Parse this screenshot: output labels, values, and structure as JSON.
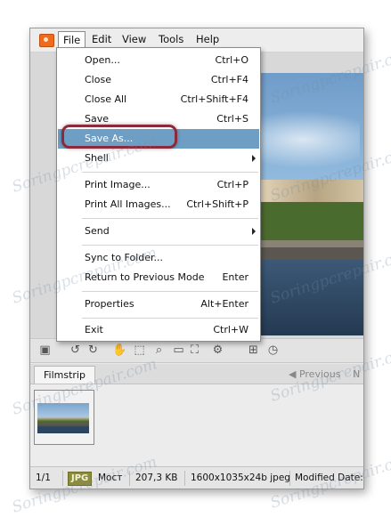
{
  "menubar": {
    "items": [
      {
        "label": "File",
        "open": true
      },
      {
        "label": "Edit"
      },
      {
        "label": "View"
      },
      {
        "label": "Tools"
      },
      {
        "label": "Help"
      }
    ]
  },
  "file_menu": {
    "items": [
      {
        "label": "Open...",
        "shortcut": "Ctrl+O"
      },
      {
        "label": "Close",
        "shortcut": "Ctrl+F4"
      },
      {
        "label": "Close All",
        "shortcut": "Ctrl+Shift+F4"
      },
      {
        "label": "Save",
        "shortcut": "Ctrl+S"
      },
      {
        "label": "Save As...",
        "shortcut": "",
        "highlighted": true
      },
      {
        "label": "Shell",
        "shortcut": "",
        "submenu": true
      },
      {
        "label": "Print Image...",
        "shortcut": "Ctrl+P"
      },
      {
        "label": "Print All Images...",
        "shortcut": "Ctrl+Shift+P"
      },
      {
        "label": "Send",
        "shortcut": "",
        "submenu": true
      },
      {
        "label": "Sync to Folder...",
        "shortcut": ""
      },
      {
        "label": "Return to Previous Mode",
        "shortcut": "Enter"
      },
      {
        "label": "Properties",
        "shortcut": "Alt+Enter"
      },
      {
        "label": "Exit",
        "shortcut": "Ctrl+W"
      }
    ]
  },
  "toolbar": {
    "icons": [
      "save-icon",
      "rotate-left-icon",
      "rotate-right-icon",
      "hand-tool-icon",
      "select-tool-icon",
      "zoom-icon",
      "fit-icon",
      "fullscreen-icon",
      "settings-icon",
      "adjust-icon",
      "timer-icon"
    ]
  },
  "filmstrip": {
    "tab_label": "Filmstrip",
    "previous_label": "◀ Previous",
    "next_label": "N"
  },
  "statusbar": {
    "index": "1/1",
    "format": "JPG",
    "name": "Мост",
    "size": "207,3 KB",
    "info": "1600x1035x24b jpeg",
    "modified": "Modified Date:"
  },
  "watermark": "Soringpcrepair.com",
  "colors": {
    "menu_highlight": "#6f9ec5",
    "highlight_ring": "#8a2a3a",
    "badge": "#8c8c3c",
    "app_icon": "#f06a1e"
  }
}
